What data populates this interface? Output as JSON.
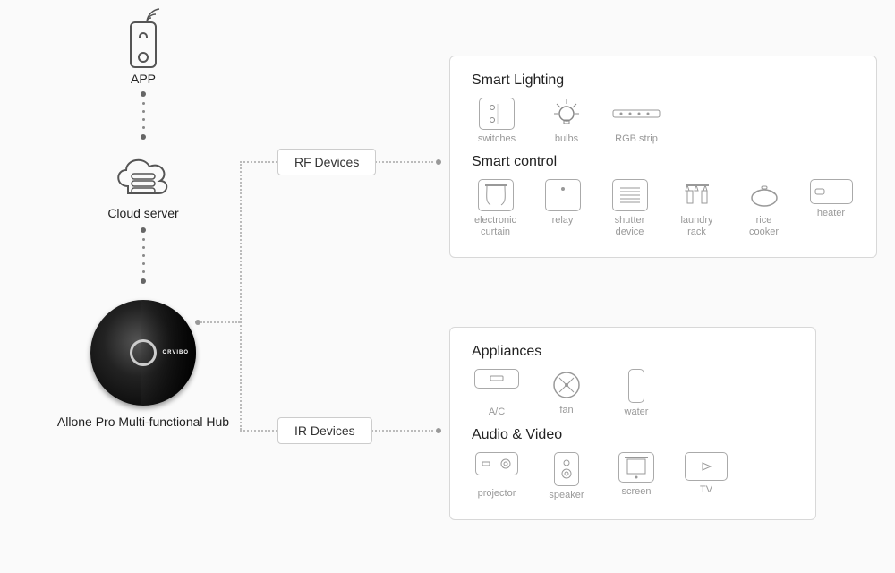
{
  "left": {
    "app_label": "APP",
    "cloud_label": "Cloud server",
    "hub_label": "Allone Pro Multi-functional Hub",
    "hub_brand": "ORVIBO"
  },
  "tags": {
    "rf": "RF Devices",
    "ir": "IR Devices"
  },
  "rf_panel": {
    "lighting_title": "Smart Lighting",
    "lighting": [
      {
        "label": "switches"
      },
      {
        "label": "bulbs"
      },
      {
        "label": "RGB strip"
      }
    ],
    "control_title": "Smart control",
    "control": [
      {
        "label": "electronic curtain"
      },
      {
        "label": "relay"
      },
      {
        "label": "shutter device"
      },
      {
        "label": "laundry rack"
      },
      {
        "label": "rice cooker"
      },
      {
        "label": "heater"
      }
    ]
  },
  "ir_panel": {
    "appliances_title": "Appliances",
    "appliances": [
      {
        "label": "A/C"
      },
      {
        "label": "fan"
      },
      {
        "label": "water"
      }
    ],
    "av_title": "Audio & Video",
    "av": [
      {
        "label": "projector"
      },
      {
        "label": "speaker"
      },
      {
        "label": "screen"
      },
      {
        "label": "TV"
      }
    ]
  }
}
